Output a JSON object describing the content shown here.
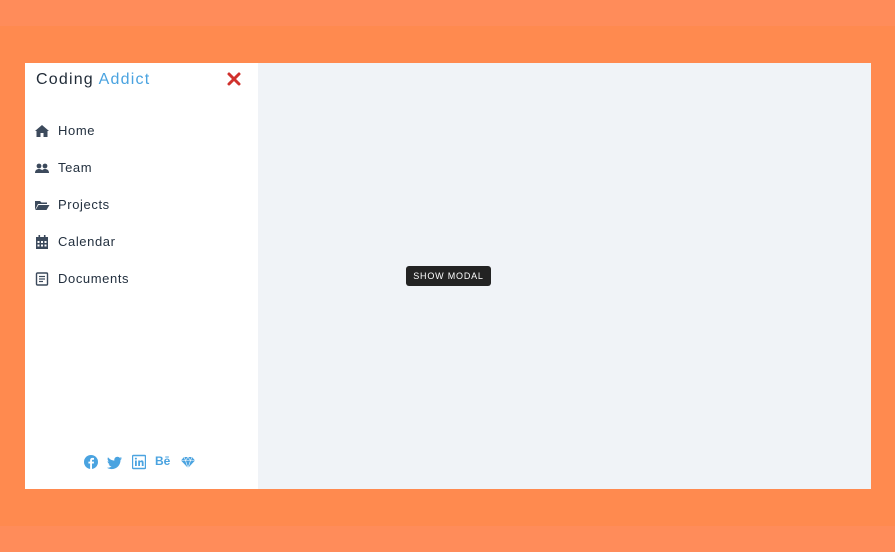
{
  "brand": {
    "part1": "Coding",
    "part2": "Addict"
  },
  "sidebar": {
    "close_icon": "close-icon",
    "items": [
      {
        "label": "Home",
        "icon": "home-icon"
      },
      {
        "label": "Team",
        "icon": "team-icon"
      },
      {
        "label": "Projects",
        "icon": "folder-open-icon"
      },
      {
        "label": "Calendar",
        "icon": "calendar-icon"
      },
      {
        "label": "Documents",
        "icon": "document-icon"
      }
    ],
    "social": [
      {
        "icon": "facebook-icon"
      },
      {
        "icon": "twitter-icon"
      },
      {
        "icon": "linkedin-icon"
      },
      {
        "icon": "behance-icon",
        "text": "Bē"
      },
      {
        "icon": "sketch-icon"
      }
    ]
  },
  "main": {
    "show_modal_label": "SHOW MODAL"
  },
  "colors": {
    "background": "#ff8a4f",
    "accent": "#4aa3e0",
    "close": "#d0312d",
    "sidebar_icon": "#3c4a5c",
    "button_bg": "#232323"
  }
}
